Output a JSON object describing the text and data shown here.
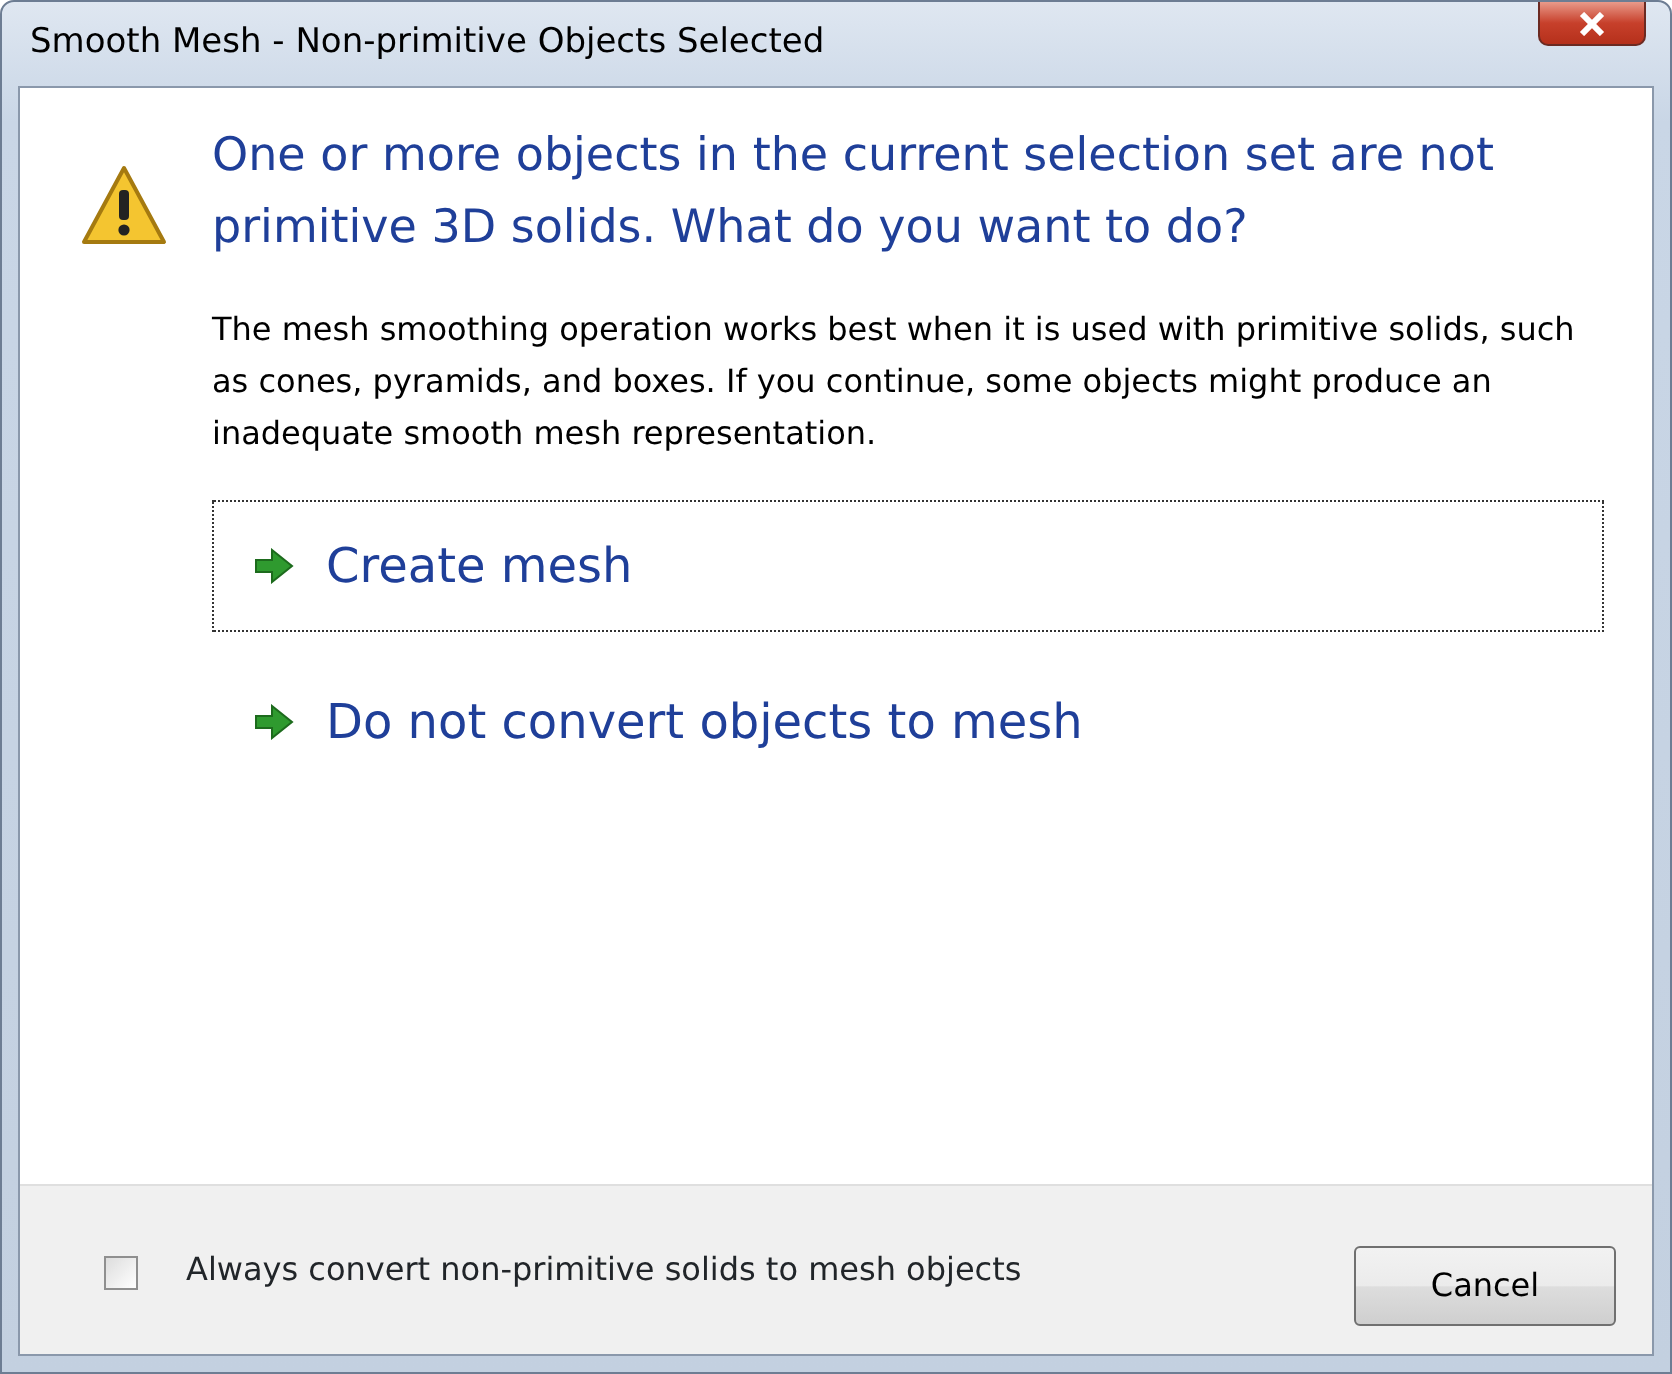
{
  "window": {
    "title": "Smooth Mesh - Non-primitive Objects Selected"
  },
  "heading": "One or more objects in the current selection set are not primitive 3D solids. What do you want to do?",
  "message": "The mesh smoothing operation works best when it is used with primitive solids, such as cones, pyramids, and boxes.  If you continue, some objects might produce an inadequate smooth mesh representation.",
  "commands": [
    {
      "label": "Create mesh",
      "selected": true
    },
    {
      "label": "Do not convert objects to mesh",
      "selected": false
    }
  ],
  "footer": {
    "checkbox": {
      "label": "Always convert non-primitive solids to mesh objects",
      "checked": false
    },
    "buttons": [
      "Cancel"
    ]
  }
}
